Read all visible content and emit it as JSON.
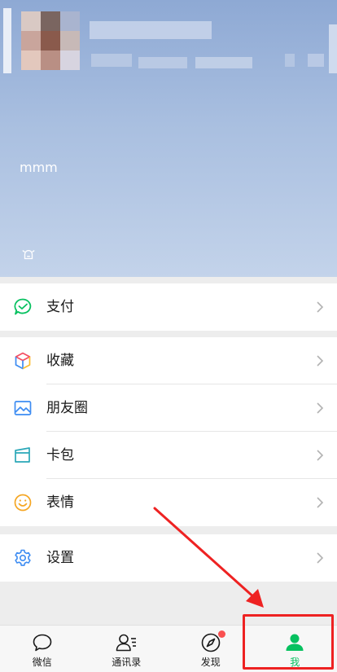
{
  "profile": {
    "status_text": "mmm"
  },
  "groups": [
    {
      "items": [
        {
          "key": "pay",
          "label": "支付",
          "icon": "pay-icon"
        }
      ]
    },
    {
      "items": [
        {
          "key": "favorites",
          "label": "收藏",
          "icon": "cube-icon"
        },
        {
          "key": "moments",
          "label": "朋友圈",
          "icon": "image-icon"
        },
        {
          "key": "cards",
          "label": "卡包",
          "icon": "card-icon"
        },
        {
          "key": "stickers",
          "label": "表情",
          "icon": "smile-icon"
        }
      ]
    },
    {
      "items": [
        {
          "key": "settings",
          "label": "设置",
          "icon": "gear-icon"
        }
      ]
    }
  ],
  "tabbar": {
    "tabs": [
      {
        "label": "微信",
        "icon": "chat-bubble-icon"
      },
      {
        "label": "通讯录",
        "icon": "contacts-icon"
      },
      {
        "label": "发现",
        "icon": "compass-icon"
      },
      {
        "label": "我",
        "icon": "person-icon"
      }
    ],
    "active_index": 3
  },
  "colors": {
    "accent": "#07c160",
    "badge": "#fa5151",
    "annotation": "#ee2222"
  }
}
